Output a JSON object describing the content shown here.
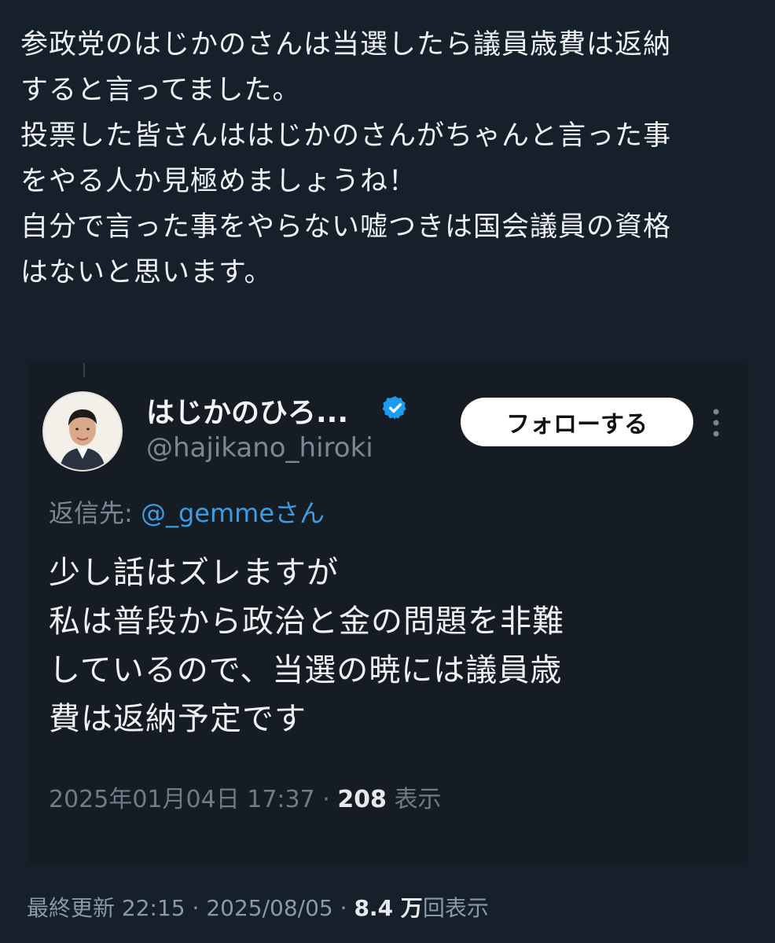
{
  "post": {
    "lines": [
      "参政党のはじかのさんは当選したら議員歳費は返納",
      "すると言ってました。",
      "投票した皆さんははじかのさんがちゃんと言った事",
      "をやる人か見極めましょうね！",
      "自分で言った事をやらない嘘つきは国会議員の資格",
      "はないと思います。"
    ],
    "meta": {
      "last_updated_label": "最終更新",
      "time": "22:15",
      "date": "2025/08/05",
      "views_count": "8.4 万",
      "views_label": "回表示"
    }
  },
  "embedded_tweet": {
    "display_name": "はじかのひろ...",
    "handle": "@hajikano_hiroki",
    "follow_label": "フォローする",
    "reply_to_label": "返信先:",
    "reply_to_mention": "@_gemmeさん",
    "lines": [
      "少し話はズレますが",
      "私は普段から政治と金の問題を非難",
      "しているので、当選の暁には議員歳",
      "費は返納予定です"
    ],
    "timestamp": "2025年01月04日 17:37",
    "views_count": "208",
    "views_label": "表示"
  },
  "icons": {
    "verified": "verified-badge-icon",
    "more": "more-options-icon"
  },
  "colors": {
    "background": "#15202b",
    "accent_blue": "#1d9bf0",
    "text": "#e7e9ea",
    "muted": "#8b98a5"
  }
}
